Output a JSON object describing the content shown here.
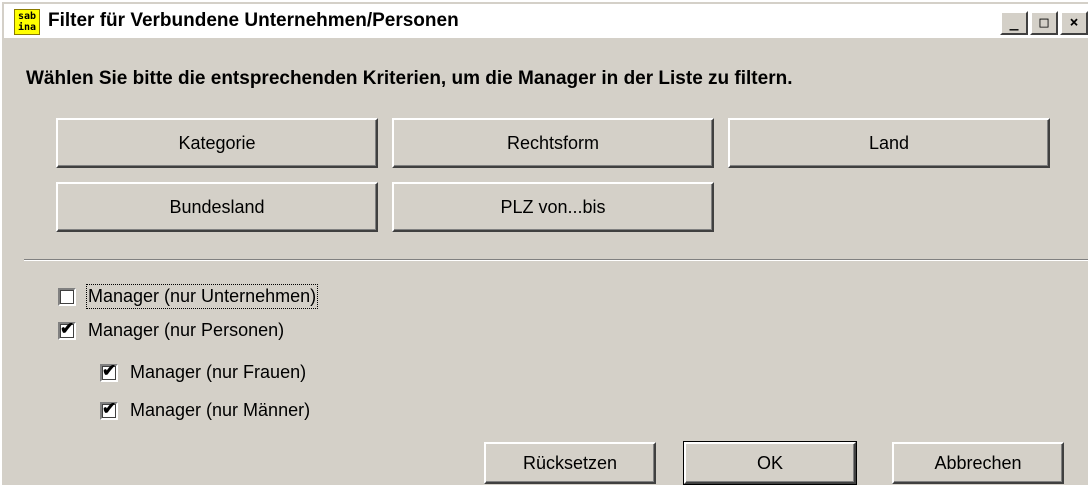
{
  "window": {
    "title": "Filter für Verbundene Unternehmen/Personen",
    "icon_text": "sab\nina",
    "controls": {
      "minimize": "_",
      "maximize": "□",
      "close": "×"
    }
  },
  "instruction": "Wählen Sie bitte die entsprechenden Kriterien, um die Manager in der Liste zu filtern.",
  "filter_buttons": {
    "kategorie": "Kategorie",
    "rechtsform": "Rechtsform",
    "land": "Land",
    "bundesland": "Bundesland",
    "plz": "PLZ von...bis"
  },
  "checkboxes": [
    {
      "label": "Manager (nur Unternehmen)",
      "checked": false
    },
    {
      "label": "Manager (nur Personen)",
      "checked": true
    },
    {
      "label": "Manager (nur Frauen)",
      "checked": true
    },
    {
      "label": "Manager (nur Männer)",
      "checked": true
    }
  ],
  "check_glyph": "✔",
  "actions": {
    "reset": "Rücksetzen",
    "ok": "OK",
    "cancel": "Abbrechen"
  },
  "colors": {
    "face": "#d4d0c8",
    "icon_bg": "#ffff00"
  }
}
